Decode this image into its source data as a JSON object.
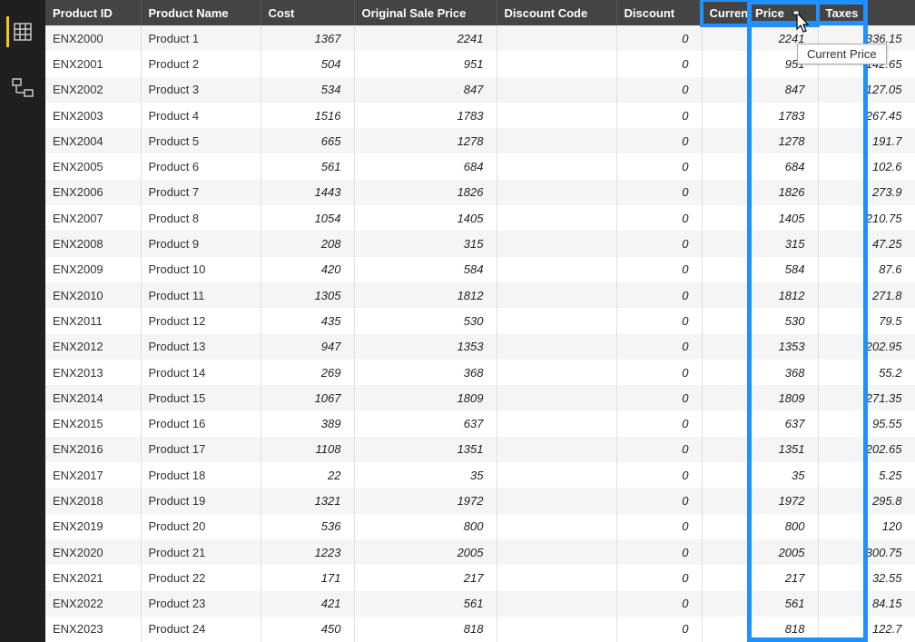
{
  "sidebar": {
    "data_view_active": true
  },
  "tooltip": "Current Price",
  "columns": [
    {
      "key": "id",
      "label": "Product ID"
    },
    {
      "key": "name",
      "label": "Product Name"
    },
    {
      "key": "cost",
      "label": "Cost"
    },
    {
      "key": "osp",
      "label": "Original Sale Price"
    },
    {
      "key": "dc",
      "label": "Discount Code"
    },
    {
      "key": "disc",
      "label": "Discount"
    },
    {
      "key": "curr",
      "label": "Current Price"
    },
    {
      "key": "tax",
      "label": "Taxes"
    }
  ],
  "selected_column": "curr",
  "rows": [
    {
      "id": "ENX2000",
      "name": "Product 1",
      "cost": "1367",
      "osp": "2241",
      "dc": "",
      "disc": "0",
      "curr": "2241",
      "tax": "336.15"
    },
    {
      "id": "ENX2001",
      "name": "Product 2",
      "cost": "504",
      "osp": "951",
      "dc": "",
      "disc": "0",
      "curr": "951",
      "tax": "142.65"
    },
    {
      "id": "ENX2002",
      "name": "Product 3",
      "cost": "534",
      "osp": "847",
      "dc": "",
      "disc": "0",
      "curr": "847",
      "tax": "127.05"
    },
    {
      "id": "ENX2003",
      "name": "Product 4",
      "cost": "1516",
      "osp": "1783",
      "dc": "",
      "disc": "0",
      "curr": "1783",
      "tax": "267.45"
    },
    {
      "id": "ENX2004",
      "name": "Product 5",
      "cost": "665",
      "osp": "1278",
      "dc": "",
      "disc": "0",
      "curr": "1278",
      "tax": "191.7"
    },
    {
      "id": "ENX2005",
      "name": "Product 6",
      "cost": "561",
      "osp": "684",
      "dc": "",
      "disc": "0",
      "curr": "684",
      "tax": "102.6"
    },
    {
      "id": "ENX2006",
      "name": "Product 7",
      "cost": "1443",
      "osp": "1826",
      "dc": "",
      "disc": "0",
      "curr": "1826",
      "tax": "273.9"
    },
    {
      "id": "ENX2007",
      "name": "Product 8",
      "cost": "1054",
      "osp": "1405",
      "dc": "",
      "disc": "0",
      "curr": "1405",
      "tax": "210.75"
    },
    {
      "id": "ENX2008",
      "name": "Product 9",
      "cost": "208",
      "osp": "315",
      "dc": "",
      "disc": "0",
      "curr": "315",
      "tax": "47.25"
    },
    {
      "id": "ENX2009",
      "name": "Product 10",
      "cost": "420",
      "osp": "584",
      "dc": "",
      "disc": "0",
      "curr": "584",
      "tax": "87.6"
    },
    {
      "id": "ENX2010",
      "name": "Product 11",
      "cost": "1305",
      "osp": "1812",
      "dc": "",
      "disc": "0",
      "curr": "1812",
      "tax": "271.8"
    },
    {
      "id": "ENX2011",
      "name": "Product 12",
      "cost": "435",
      "osp": "530",
      "dc": "",
      "disc": "0",
      "curr": "530",
      "tax": "79.5"
    },
    {
      "id": "ENX2012",
      "name": "Product 13",
      "cost": "947",
      "osp": "1353",
      "dc": "",
      "disc": "0",
      "curr": "1353",
      "tax": "202.95"
    },
    {
      "id": "ENX2013",
      "name": "Product 14",
      "cost": "269",
      "osp": "368",
      "dc": "",
      "disc": "0",
      "curr": "368",
      "tax": "55.2"
    },
    {
      "id": "ENX2014",
      "name": "Product 15",
      "cost": "1067",
      "osp": "1809",
      "dc": "",
      "disc": "0",
      "curr": "1809",
      "tax": "271.35"
    },
    {
      "id": "ENX2015",
      "name": "Product 16",
      "cost": "389",
      "osp": "637",
      "dc": "",
      "disc": "0",
      "curr": "637",
      "tax": "95.55"
    },
    {
      "id": "ENX2016",
      "name": "Product 17",
      "cost": "1108",
      "osp": "1351",
      "dc": "",
      "disc": "0",
      "curr": "1351",
      "tax": "202.65"
    },
    {
      "id": "ENX2017",
      "name": "Product 18",
      "cost": "22",
      "osp": "35",
      "dc": "",
      "disc": "0",
      "curr": "35",
      "tax": "5.25"
    },
    {
      "id": "ENX2018",
      "name": "Product 19",
      "cost": "1321",
      "osp": "1972",
      "dc": "",
      "disc": "0",
      "curr": "1972",
      "tax": "295.8"
    },
    {
      "id": "ENX2019",
      "name": "Product 20",
      "cost": "536",
      "osp": "800",
      "dc": "",
      "disc": "0",
      "curr": "800",
      "tax": "120"
    },
    {
      "id": "ENX2020",
      "name": "Product 21",
      "cost": "1223",
      "osp": "2005",
      "dc": "",
      "disc": "0",
      "curr": "2005",
      "tax": "300.75"
    },
    {
      "id": "ENX2021",
      "name": "Product 22",
      "cost": "171",
      "osp": "217",
      "dc": "",
      "disc": "0",
      "curr": "217",
      "tax": "32.55"
    },
    {
      "id": "ENX2022",
      "name": "Product 23",
      "cost": "421",
      "osp": "561",
      "dc": "",
      "disc": "0",
      "curr": "561",
      "tax": "84.15"
    },
    {
      "id": "ENX2023",
      "name": "Product 24",
      "cost": "450",
      "osp": "818",
      "dc": "",
      "disc": "0",
      "curr": "818",
      "tax": "122.7"
    }
  ]
}
